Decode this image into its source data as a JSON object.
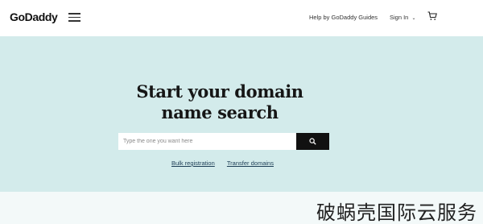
{
  "header": {
    "logo_text": "GoDaddy",
    "help_link": "Help by GoDaddy Guides",
    "signin_label": "Sign In",
    "signin_icon": "chevron-down-icon",
    "menu_icon": "hamburger-menu-icon",
    "cart_icon": "cart-icon"
  },
  "hero": {
    "title_line1": "Start your domain",
    "title_line2": "name search",
    "search": {
      "placeholder": "Type the one you want here",
      "button_icon": "search-icon"
    },
    "links": {
      "bulk": "Bulk registration",
      "transfer": "Transfer domains"
    },
    "background_color": "#d3ebeb"
  },
  "watermark": "破蜗壳国际云服务"
}
